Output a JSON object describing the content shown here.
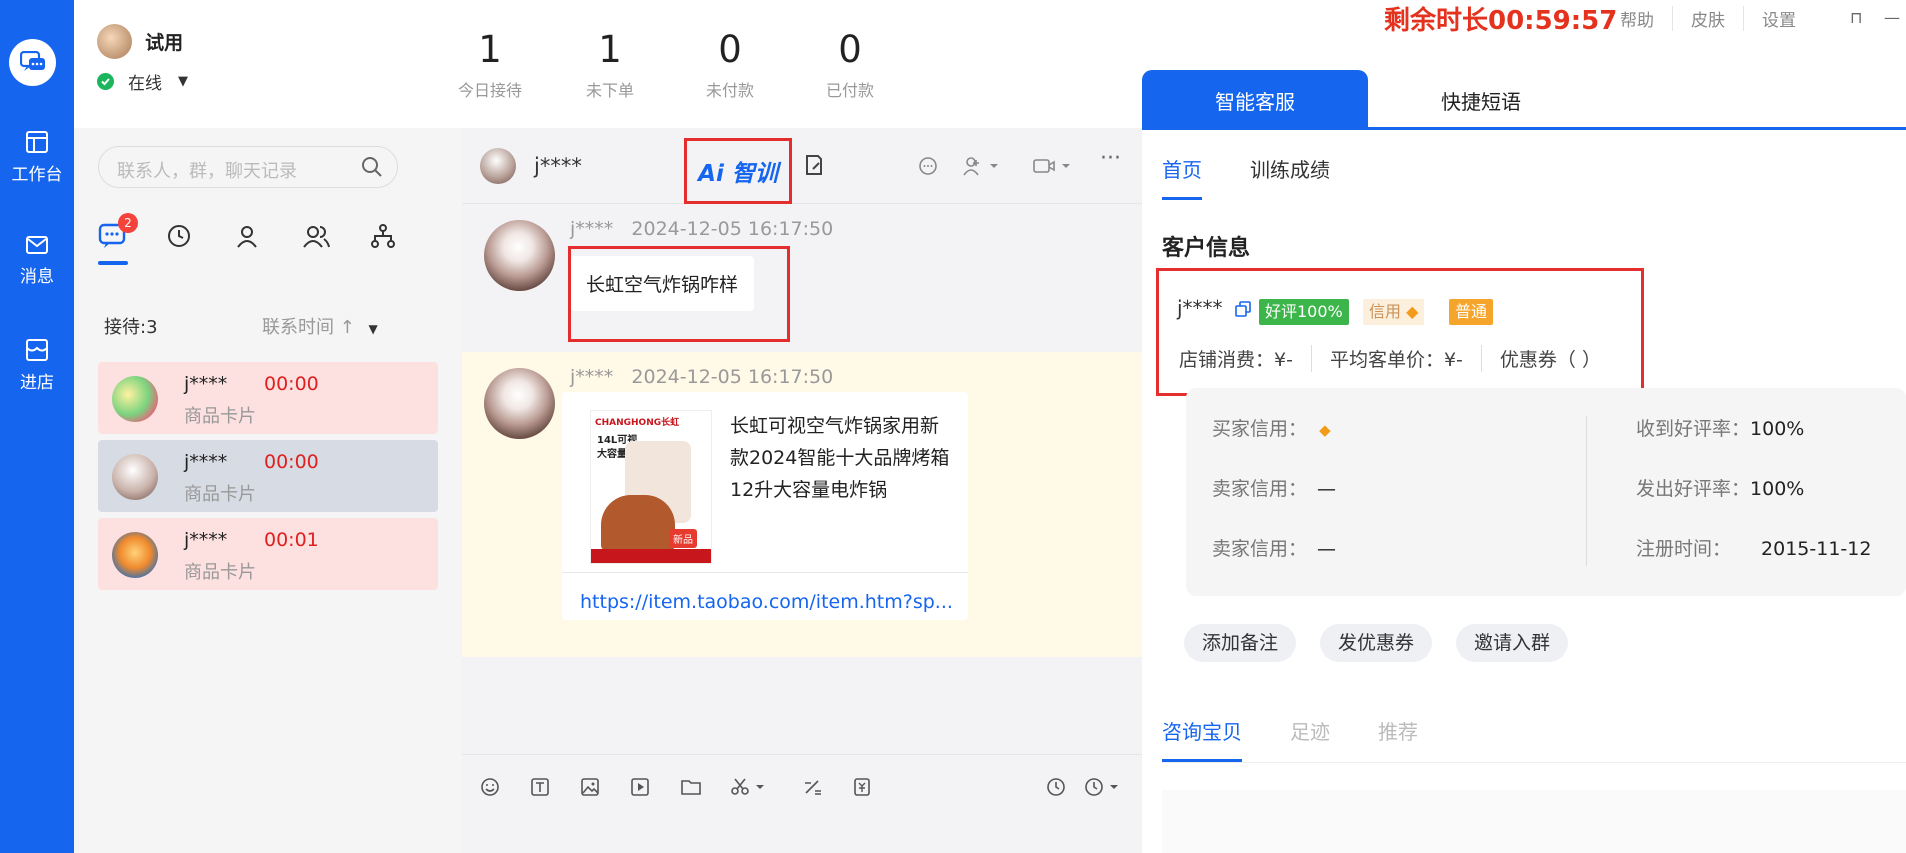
{
  "header": {
    "user_name": "试用",
    "status": "在线",
    "stats": [
      {
        "value": "1",
        "label": "今日接待"
      },
      {
        "value": "1",
        "label": "未下单"
      },
      {
        "value": "0",
        "label": "未付款"
      },
      {
        "value": "0",
        "label": "已付款"
      }
    ],
    "timer": "剩余时长00:59:57",
    "links": [
      "帮助",
      "皮肤",
      "设置"
    ]
  },
  "rail": {
    "items": [
      {
        "label": "工作台",
        "icon": "workbench-icon"
      },
      {
        "label": "消息",
        "icon": "mail-icon"
      },
      {
        "label": "进店",
        "icon": "store-icon"
      }
    ]
  },
  "contacts": {
    "search_placeholder": "联系人，群，聊天记录",
    "badge_count": "2",
    "queue_label": "接待:3",
    "sort_label": "联系时间 ↑",
    "items": [
      {
        "name": "j****",
        "time": "00:00",
        "subtitle": "商品卡片",
        "bg": "#fde0e0"
      },
      {
        "name": "j****",
        "time": "00:00",
        "subtitle": "商品卡片",
        "bg": "#d7dbe3"
      },
      {
        "name": "j****",
        "time": "00:01",
        "subtitle": "商品卡片",
        "bg": "#fde0e0"
      }
    ]
  },
  "chat": {
    "contact_name": "j****",
    "ai_label": "Ai 智训",
    "messages": [
      {
        "sender": "j****",
        "time": "2024-12-05 16:17:50",
        "text": "长虹空气炸锅咋样"
      },
      {
        "sender": "j****",
        "time": "2024-12-05 16:17:50",
        "product_title": "长虹可视空气炸锅家用新款2024智能十大品牌烤箱12升大容量电炸锅",
        "product_image_text": [
          "CHANGHONG长虹",
          "14L可视",
          "大容量",
          "新品"
        ],
        "link": "https://item.taobao.com/item.htm?sp..."
      }
    ]
  },
  "right_panel": {
    "tabs": [
      "智能客服",
      "快捷短语"
    ],
    "sub_tabs": [
      "首页",
      "训练成绩"
    ],
    "section_title": "客户信息",
    "customer": {
      "name": "j****",
      "tags": [
        "好评100%",
        "信用",
        "普通"
      ],
      "shop_spend": "店铺消费：¥-",
      "avg_price": "平均客单价：¥-",
      "coupons": "优惠券（ ）"
    },
    "info_left": [
      {
        "label": "买家信用：",
        "value": ""
      },
      {
        "label": "卖家信用：",
        "value": "—"
      },
      {
        "label": "卖家信用：",
        "value": "—"
      }
    ],
    "info_right": [
      {
        "label": "收到好评率：",
        "value": "100%"
      },
      {
        "label": "发出好评率：",
        "value": "100%"
      },
      {
        "label": "注册时间：",
        "value": "2015-11-12"
      }
    ],
    "actions": [
      "添加备注",
      "发优惠券",
      "邀请入群"
    ],
    "bottom_tabs": [
      "咨询宝贝",
      "足迹",
      "推荐"
    ]
  },
  "colors": {
    "brand": "#1565ef",
    "alert": "#e5321f",
    "highlight": "#e42d2d"
  }
}
